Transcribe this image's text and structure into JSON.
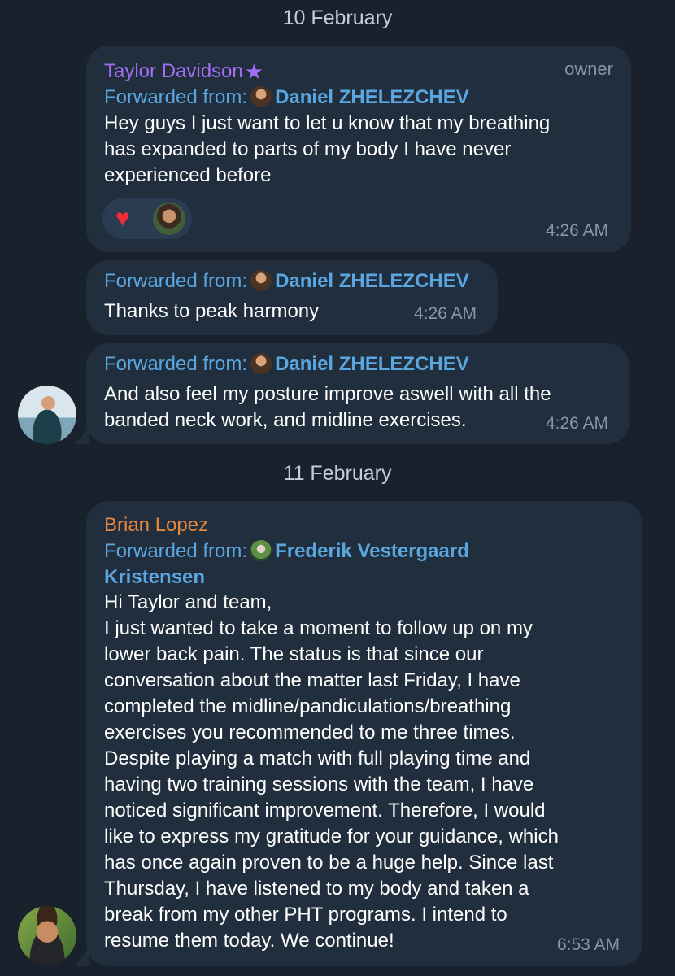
{
  "dates": [
    "10 February",
    "11 February"
  ],
  "forward_label": "Forwarded from:",
  "messages": [
    {
      "sender": "Taylor Davidson",
      "role": "owner",
      "forwarded_from": "Daniel ZHELEZCHEV",
      "lines": [
        "Hey guys I just want to let u know that my breathing",
        "has expanded to parts of my body I have never",
        "experienced before"
      ],
      "reaction": "❤️",
      "time": "4:26 AM"
    },
    {
      "forwarded_from": "Daniel ZHELEZCHEV",
      "lines": [
        "Thanks to peak harmony"
      ],
      "time": "4:26 AM"
    },
    {
      "forwarded_from": "Daniel ZHELEZCHEV",
      "lines": [
        "And also feel my posture improve aswell with all the",
        "banded neck work, and midline exercises."
      ],
      "time": "4:26 AM"
    },
    {
      "sender": "Brian Lopez",
      "forwarded_from_line1": "Frederik Vestergaard",
      "forwarded_from_line2": "Kristensen",
      "lines": [
        "Hi Taylor and team,",
        "I just wanted to take a moment to follow up on my",
        "lower back pain. The status is that since our",
        "conversation about the matter last Friday, I have",
        "completed the midline/pandiculations/breathing",
        "exercises you recommended to me three times.",
        "Despite playing a match with full playing time and",
        "having two training sessions with the team, I have",
        "noticed significant improvement. Therefore, I would",
        "like to express my gratitude for your guidance, which",
        "has once again proven to be a huge help. Since last",
        "Thursday, I have listened to my body and taken a",
        "break from my other PHT programs. I intend to",
        "resume them today. We continue!"
      ],
      "time": "6:53 AM"
    }
  ],
  "icons": {
    "premium": "star-icon",
    "reaction": "heart-icon"
  },
  "colors": {
    "background": "#18212c",
    "bubble": "#212e3d",
    "taylor_name": "#a26ef4",
    "brian_name": "#e4883e",
    "forward": "#5aa6e0",
    "heart": "#f22c3a"
  }
}
